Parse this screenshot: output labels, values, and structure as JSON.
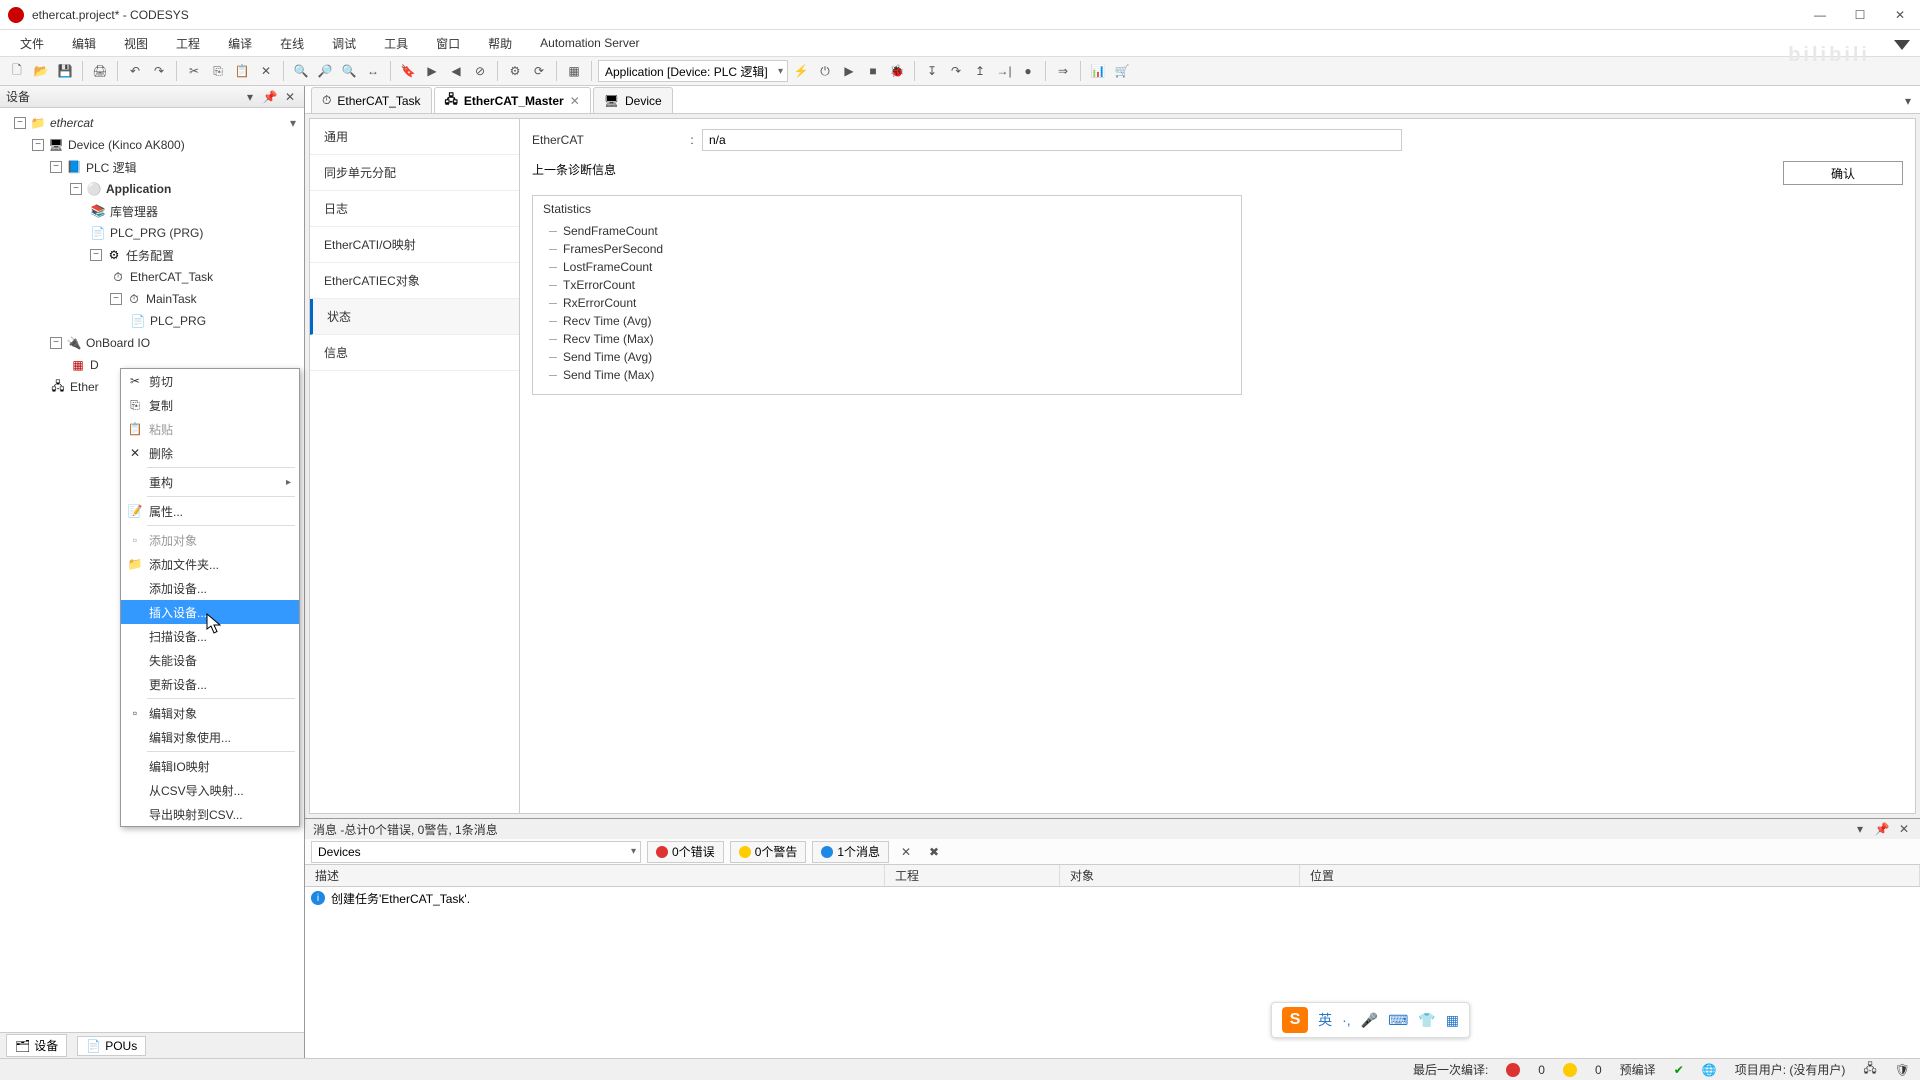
{
  "window": {
    "title": "ethercat.project* - CODESYS"
  },
  "menus": [
    "文件",
    "编辑",
    "视图",
    "工程",
    "编译",
    "在线",
    "调试",
    "工具",
    "窗口",
    "帮助",
    "Automation Server"
  ],
  "toolbar": {
    "app_combo": "Application [Device: PLC 逻辑]"
  },
  "devices_panel": {
    "title": "设备",
    "root": "ethercat",
    "device": "Device (Kinco AK800)",
    "plc": "PLC 逻辑",
    "application": "Application",
    "lib": "库管理器",
    "plcprg": "PLC_PRG (PRG)",
    "taskcfg": "任务配置",
    "ethercat_task": "EtherCAT_Task",
    "maintask": "MainTask",
    "plcprg2": "PLC_PRG",
    "onboard": "OnBoard IO",
    "do_node": "D",
    "ethercat_master": "Ether"
  },
  "context_menu": {
    "cut": "剪切",
    "copy": "复制",
    "paste": "粘贴",
    "delete": "删除",
    "refactor": "重构",
    "props": "属性...",
    "add_obj": "添加对象",
    "add_folder": "添加文件夹...",
    "add_device": "添加设备...",
    "insert_device": "插入设备...",
    "scan_device": "扫描设备...",
    "disable_device": "失能设备",
    "update_device": "更新设备...",
    "edit_obj": "编辑对象",
    "edit_obj_use": "编辑对象使用...",
    "edit_io": "编辑IO映射",
    "import_csv": "从CSV导入映射...",
    "export_csv": "导出映射到CSV..."
  },
  "bottom_tabs": {
    "devices": "设备",
    "pous": "POUs"
  },
  "tabs": {
    "ethercat_task": "EtherCAT_Task",
    "ethercat_master": "EtherCAT_Master",
    "device": "Device"
  },
  "side_nav": [
    "通用",
    "同步单元分配",
    "日志",
    "EtherCATI/O映射",
    "EtherCATIEC对象",
    "状态",
    "信息"
  ],
  "content": {
    "ec_label": "EtherCAT",
    "colon": ":",
    "na": "n/a",
    "last_diag": "上一条诊断信息",
    "ok_btn": "确认",
    "stats_title": "Statistics",
    "stats_items": [
      "SendFrameCount",
      "FramesPerSecond",
      "LostFrameCount",
      "TxErrorCount",
      "RxErrorCount",
      "Recv Time (Avg)",
      "Recv Time (Max)",
      "Send Time (Avg)",
      "Send Time (Max)"
    ]
  },
  "messages": {
    "header": "消息 -总计0个错误, 0警告, 1条消息",
    "combo": "Devices",
    "errors": "0个错误",
    "warnings": "0个警告",
    "infos": "1个消息",
    "col_desc": "描述",
    "col_proj": "工程",
    "col_obj": "对象",
    "col_pos": "位置",
    "row1": "创建任务'EtherCAT_Task'."
  },
  "status": {
    "last_compile": "最后一次编译:",
    "err0": "0",
    "warn0": "0",
    "pre_compile": "预编译 ",
    "proj_user": "项目用户: (没有用户)"
  },
  "ime": {
    "lang": "英",
    "sep": "·,"
  },
  "watermark": "bilibili"
}
